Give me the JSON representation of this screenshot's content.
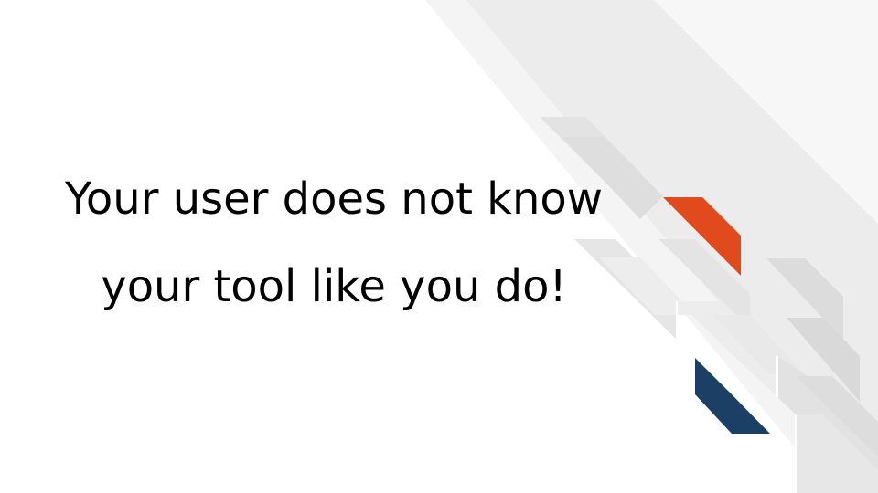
{
  "slide": {
    "headline_line_1": "Your user does not know",
    "headline_line_2": "your tool like you do!"
  },
  "colors": {
    "background": "#ffffff",
    "text": "#000000",
    "accent_orange": "#e04a1c",
    "accent_navy": "#1c3f66",
    "stripe_light": "#f3f3f3",
    "stripe_mid": "#ebebeb",
    "stripe_dark": "#dcdcdc"
  }
}
